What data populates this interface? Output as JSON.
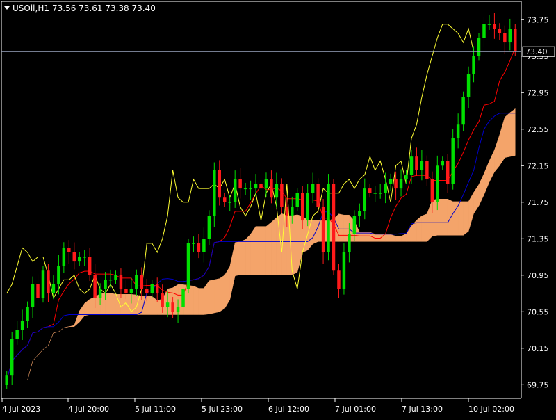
{
  "header": {
    "symbol": "USOil,H1",
    "ohlc": "73.56 73.61 73.38 73.40"
  },
  "current_price_label": "73.40",
  "colors": {
    "background": "#000000",
    "frame": "#ffffff",
    "bull": "#00e000",
    "bear": "#ff1a1a",
    "tenkan": "#ff0000",
    "kijun": "#0000cc",
    "chikou": "#ffff33",
    "kumo_bull": "#f4a46a",
    "kumo_bear": "#d8b4dc",
    "price_line": "#9aa5c0"
  },
  "chart_data": {
    "type": "candlestick",
    "indicator": "Ichimoku Kinko Hyo",
    "ylim": [
      69.6,
      73.95
    ],
    "y_ticks": [
      "73.75",
      "73.35",
      "72.95",
      "72.55",
      "72.15",
      "71.75",
      "71.35",
      "70.95",
      "70.55",
      "70.15",
      "69.75"
    ],
    "x_ticks": [
      "4 Jul 2023",
      "4 Jul 20:00",
      "5 Jul 11:00",
      "5 Jul 23:00",
      "6 Jul 12:00",
      "7 Jul 01:00",
      "7 Jul 13:00",
      "10 Jul 02:00"
    ],
    "last_price": 73.4,
    "candles_close": [
      69.85,
      70.25,
      70.35,
      70.45,
      70.6,
      70.85,
      70.7,
      71.0,
      70.75,
      70.85,
      71.05,
      71.25,
      71.2,
      71.1,
      71.15,
      71.15,
      70.95,
      70.7,
      70.8,
      70.9,
      70.9,
      70.95,
      70.8,
      70.75,
      70.8,
      70.95,
      70.8,
      70.75,
      70.85,
      70.75,
      70.6,
      70.65,
      70.55,
      70.6,
      70.8,
      71.3,
      71.3,
      71.2,
      71.35,
      71.6,
      72.1,
      71.8,
      71.75,
      71.75,
      72.0,
      71.9,
      71.9,
      71.9,
      71.95,
      71.9,
      72.0,
      71.8,
      71.95,
      71.7,
      71.6,
      71.7,
      71.85,
      71.55,
      71.85,
      71.95,
      71.7,
      71.2,
      71.95,
      71.0,
      70.8,
      71.2,
      71.4,
      71.6,
      71.65,
      71.9,
      71.85,
      71.85,
      71.85,
      71.95,
      72.0,
      71.9,
      72.0,
      72.05,
      72.25,
      72.1,
      72.2,
      72.0,
      71.75,
      72.15,
      72.2,
      71.95,
      72.45,
      72.6,
      72.9,
      73.15,
      73.35,
      73.55,
      73.7,
      73.7,
      73.65,
      73.6,
      73.5,
      73.65,
      73.4
    ]
  }
}
